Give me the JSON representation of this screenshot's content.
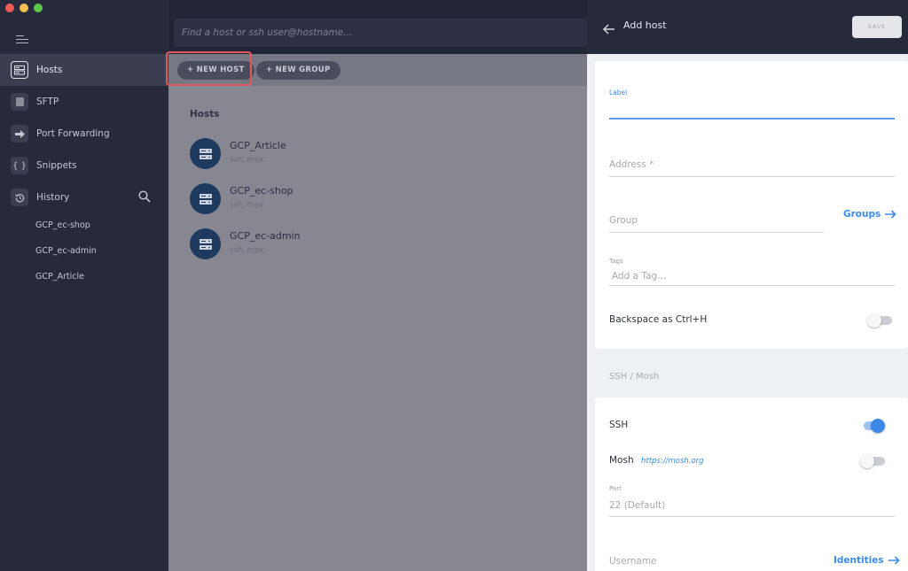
{
  "window": {
    "traffic_lights": {
      "close": "#ee5c53",
      "minimize": "#f5bd4f",
      "maximize": "#5cc84b"
    }
  },
  "sidebar": {
    "menu_icon": "hamburger-icon",
    "items": [
      {
        "label": "Hosts",
        "icon": "server-icon",
        "active": true
      },
      {
        "label": "SFTP",
        "icon": "folder-icon",
        "active": false
      },
      {
        "label": "Port Forwarding",
        "icon": "forward-arrow-icon",
        "active": false
      },
      {
        "label": "Snippets",
        "icon": "braces-icon",
        "active": false
      },
      {
        "label": "History",
        "icon": "history-icon",
        "active": false
      }
    ],
    "history_search_icon": "search-icon",
    "history": [
      "GCP_ec-shop",
      "GCP_ec-admin",
      "GCP_Article"
    ]
  },
  "search": {
    "placeholder": "Find a host or ssh user@hostname..."
  },
  "toolbar": {
    "new_host": "+ NEW HOST",
    "new_group": "+ NEW GROUP"
  },
  "hosts": {
    "title": "Hosts",
    "list": [
      {
        "name": "GCP_Article",
        "sub": "ssh, max"
      },
      {
        "name": "GCP_ec-shop",
        "sub": "ssh, max"
      },
      {
        "name": "GCP_ec-admin",
        "sub": "ssh, max"
      }
    ]
  },
  "panel": {
    "title": "Add host",
    "save": "SAVE",
    "label_field": {
      "label": "Label",
      "value": ""
    },
    "address_field": {
      "placeholder": "Address *"
    },
    "group_field": {
      "placeholder": "Group",
      "link": "Groups"
    },
    "tags_field": {
      "label": "Tags",
      "placeholder": "Add a Tag..."
    },
    "backspace": {
      "label": "Backspace as Ctrl+H",
      "on": false
    },
    "section": "SSH / Mosh",
    "ssh": {
      "label": "SSH",
      "on": true
    },
    "mosh": {
      "label": "Mosh",
      "link": "https://mosh.org",
      "on": false
    },
    "port_field": {
      "label": "Port",
      "placeholder": "22 (Default)"
    },
    "username_field": {
      "placeholder": "Username",
      "link": "Identities"
    }
  },
  "colors": {
    "accent": "#3d8be8",
    "highlight": "#e05a5a",
    "host_avatar": "#1f3a5f"
  }
}
